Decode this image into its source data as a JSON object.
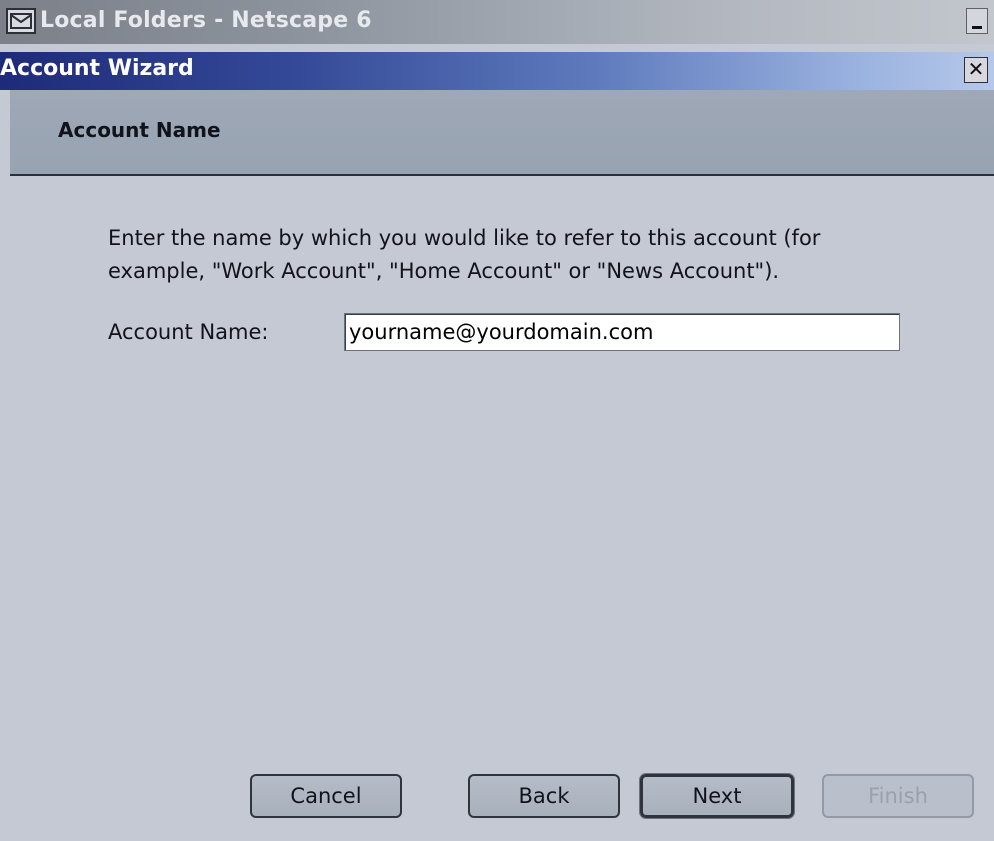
{
  "background_window": {
    "title": "Local Folders - Netscape 6",
    "icon": "mail-icon",
    "minimize_glyph": "_"
  },
  "dialog": {
    "title": "Account Wizard",
    "close_glyph": "✕"
  },
  "wizard": {
    "heading": "Account Name",
    "description": "Enter the name by which you would like to refer to this account (for example, \"Work Account\", \"Home Account\" or \"News Account\").",
    "field_label": "Account Name:",
    "field_value": "yourname@yourdomain.com"
  },
  "buttons": {
    "cancel": "Cancel",
    "back": "Back",
    "next": "Next",
    "finish": "Finish"
  },
  "colors": {
    "dialog_title_start": "#1e2a7a",
    "dialog_title_end": "#b6c8ea",
    "body_background": "#c4c9d3",
    "header_background": "#9ea8b7"
  }
}
